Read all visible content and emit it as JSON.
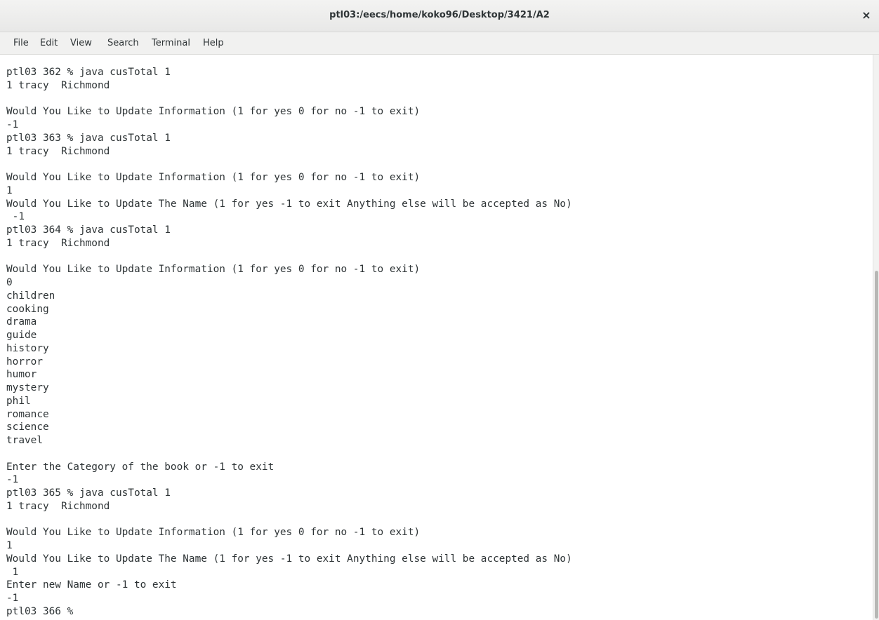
{
  "window": {
    "title": "ptl03:/eecs/home/koko96/Desktop/3421/A2",
    "close_glyph": "×"
  },
  "menu": [
    "File",
    "Edit",
    "View",
    "Search",
    "Terminal",
    "Help"
  ],
  "terminal": {
    "lines": [
      "ptl03 362 % java cusTotal 1",
      "1 tracy  Richmond",
      "",
      "Would You Like to Update Information (1 for yes 0 for no -1 to exit)",
      "-1",
      "ptl03 363 % java cusTotal 1",
      "1 tracy  Richmond",
      "",
      "Would You Like to Update Information (1 for yes 0 for no -1 to exit)",
      "1",
      "Would You Like to Update The Name (1 for yes -1 to exit Anything else will be accepted as No)",
      " -1",
      "ptl03 364 % java cusTotal 1",
      "1 tracy  Richmond",
      "",
      "Would You Like to Update Information (1 for yes 0 for no -1 to exit)",
      "0",
      "children",
      "cooking",
      "drama",
      "guide",
      "history",
      "horror",
      "humor",
      "mystery",
      "phil",
      "romance",
      "science",
      "travel",
      "",
      "Enter the Category of the book or -1 to exit",
      "-1",
      "ptl03 365 % java cusTotal 1",
      "1 tracy  Richmond",
      "",
      "Would You Like to Update Information (1 for yes 0 for no -1 to exit)",
      "1",
      "Would You Like to Update The Name (1 for yes -1 to exit Anything else will be accepted as No)",
      " 1",
      "Enter new Name or -1 to exit",
      "-1",
      "ptl03 366 % "
    ]
  }
}
